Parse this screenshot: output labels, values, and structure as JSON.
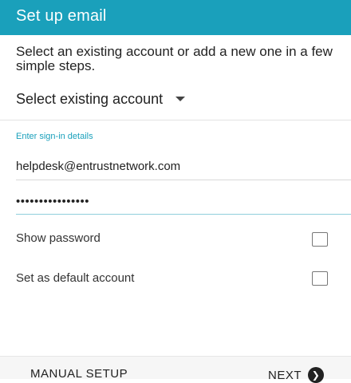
{
  "header": {
    "title": "Set up email",
    "color": "#1aa0bb"
  },
  "intro": {
    "text": "Select an existing account or add a new one in a few simple steps."
  },
  "select_account": {
    "label": "Select existing account",
    "icon": "dropdown-caret-icon"
  },
  "sign_in": {
    "section_label": "Enter sign-in details",
    "email_value": "helpdesk@entrustnetwork.com",
    "password_masked": "••••••••••••••••"
  },
  "options": {
    "show_password_label": "Show password",
    "show_password_checked": false,
    "default_account_label": "Set as default account",
    "default_account_checked": false
  },
  "footer": {
    "manual_setup_label": "MANUAL SETUP",
    "next_label": "NEXT",
    "next_icon": "chevron-right-icon"
  }
}
